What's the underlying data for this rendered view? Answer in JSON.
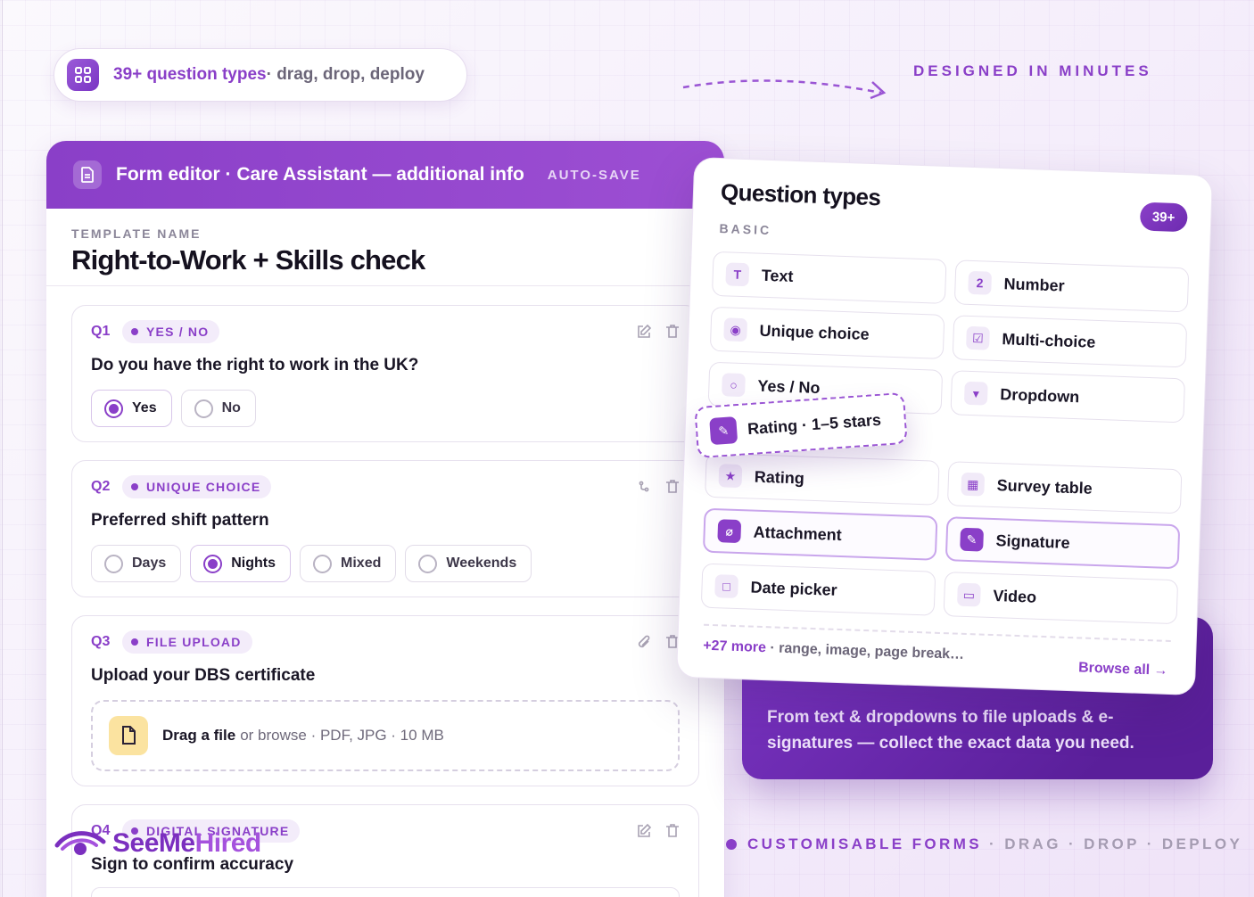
{
  "banner": {
    "strong": "39+ question types",
    "rest": " · drag, drop, deploy"
  },
  "designed": "DESIGNED IN MINUTES",
  "editor": {
    "title": "Form editor · Care Assistant — additional info",
    "autosave": "AUTO-SAVE",
    "template_label": "TEMPLATE NAME",
    "template_name": "Right-to-Work + Skills check",
    "questions": [
      {
        "num": "Q1",
        "type": "YES / NO",
        "text": "Do you have the right to work in the UK?",
        "options": [
          "Yes",
          "No"
        ],
        "selected": "Yes"
      },
      {
        "num": "Q2",
        "type": "UNIQUE CHOICE",
        "text": "Preferred shift pattern",
        "options": [
          "Days",
          "Nights",
          "Mixed",
          "Weekends"
        ],
        "selected": "Nights"
      },
      {
        "num": "Q3",
        "type": "FILE UPLOAD",
        "text": "Upload your DBS certificate",
        "drop_strong": "Drag a file",
        "drop_rest": "or browse · PDF, JPG · 10 MB"
      },
      {
        "num": "Q4",
        "type": "DIGITAL SIGNATURE",
        "text": "Sign to confirm accuracy"
      }
    ]
  },
  "question_types": {
    "title": "Question types",
    "count": "39+",
    "section": "BASIC",
    "items": [
      {
        "label": "Text",
        "icon": "T"
      },
      {
        "label": "Number",
        "icon": "2"
      },
      {
        "label": "Unique choice",
        "icon": "radio-icon"
      },
      {
        "label": "Multi-choice",
        "icon": "checkbox-icon"
      },
      {
        "label": "Yes / No",
        "icon": "circle-icon"
      },
      {
        "label": "Dropdown",
        "icon": "caret-icon"
      },
      {
        "label": "Rating",
        "icon": "star-icon"
      },
      {
        "label": "Survey table",
        "icon": "table-icon"
      },
      {
        "label": "Attachment",
        "icon": "paperclip-icon"
      },
      {
        "label": "Signature",
        "icon": "pen-icon"
      },
      {
        "label": "Date picker",
        "icon": "calendar-icon"
      },
      {
        "label": "Video",
        "icon": "video-icon"
      }
    ],
    "more_strong": "+27 more",
    "more_rest": " · range, image, page break…",
    "browse": "Browse all →"
  },
  "drag_chip": "Rating · 1–5 stars",
  "promo": "From text & dropdowns to file uploads & e-signatures — collect the exact data you need.",
  "bottom_tag": {
    "strong": "CUSTOMISABLE FORMS",
    "rest": "· DRAG · DROP · DEPLOY"
  },
  "logo": {
    "a": "SeeMe",
    "b": "Hired"
  },
  "colors": {
    "accent": "#8a3fc8",
    "accent_dark": "#5a1f9a"
  }
}
